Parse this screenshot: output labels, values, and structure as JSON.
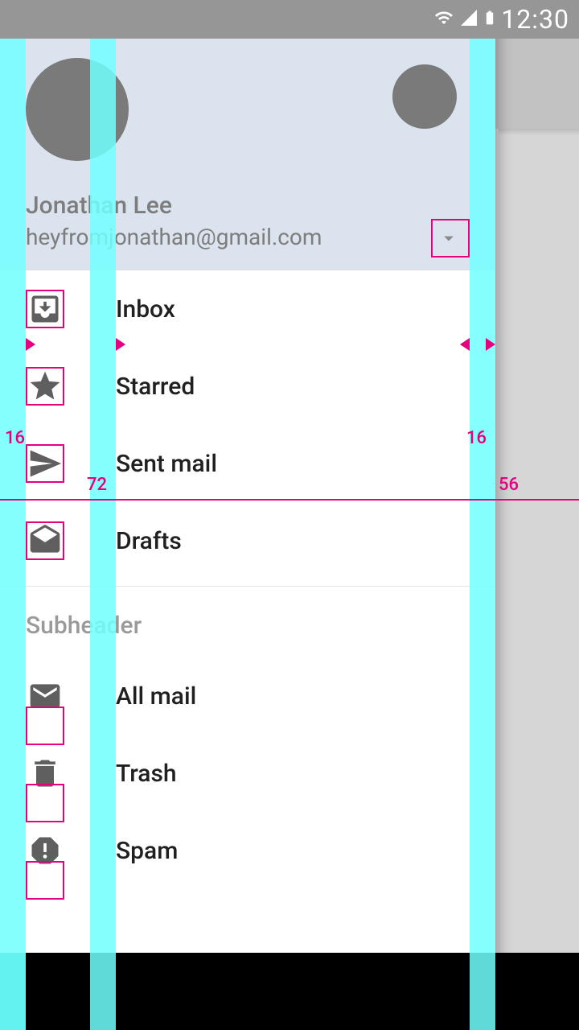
{
  "statusbar": {
    "time": "12:30"
  },
  "header": {
    "name": "Jonathan Lee",
    "email": "heyfromjonathan@gmail.com"
  },
  "nav": {
    "items": [
      {
        "label": "Inbox"
      },
      {
        "label": "Starred"
      },
      {
        "label": "Sent mail"
      },
      {
        "label": "Drafts"
      }
    ],
    "subheader": "Subheader",
    "items2": [
      {
        "label": "All mail"
      },
      {
        "label": "Trash"
      },
      {
        "label": "Spam"
      }
    ]
  },
  "redlines": {
    "left_keyline": "16",
    "content_keyline": "72",
    "right_keyline": "16",
    "drawer_to_edge": "56"
  }
}
